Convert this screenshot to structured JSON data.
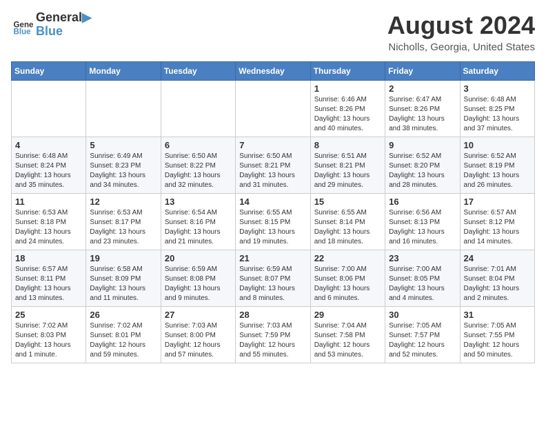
{
  "header": {
    "logo": {
      "line1": "General",
      "line2": "Blue"
    },
    "title": "August 2024",
    "location": "Nicholls, Georgia, United States"
  },
  "weekdays": [
    "Sunday",
    "Monday",
    "Tuesday",
    "Wednesday",
    "Thursday",
    "Friday",
    "Saturday"
  ],
  "weeks": [
    [
      {
        "day": "",
        "info": ""
      },
      {
        "day": "",
        "info": ""
      },
      {
        "day": "",
        "info": ""
      },
      {
        "day": "",
        "info": ""
      },
      {
        "day": "1",
        "info": "Sunrise: 6:46 AM\nSunset: 8:26 PM\nDaylight: 13 hours\nand 40 minutes."
      },
      {
        "day": "2",
        "info": "Sunrise: 6:47 AM\nSunset: 8:26 PM\nDaylight: 13 hours\nand 38 minutes."
      },
      {
        "day": "3",
        "info": "Sunrise: 6:48 AM\nSunset: 8:25 PM\nDaylight: 13 hours\nand 37 minutes."
      }
    ],
    [
      {
        "day": "4",
        "info": "Sunrise: 6:48 AM\nSunset: 8:24 PM\nDaylight: 13 hours\nand 35 minutes."
      },
      {
        "day": "5",
        "info": "Sunrise: 6:49 AM\nSunset: 8:23 PM\nDaylight: 13 hours\nand 34 minutes."
      },
      {
        "day": "6",
        "info": "Sunrise: 6:50 AM\nSunset: 8:22 PM\nDaylight: 13 hours\nand 32 minutes."
      },
      {
        "day": "7",
        "info": "Sunrise: 6:50 AM\nSunset: 8:21 PM\nDaylight: 13 hours\nand 31 minutes."
      },
      {
        "day": "8",
        "info": "Sunrise: 6:51 AM\nSunset: 8:21 PM\nDaylight: 13 hours\nand 29 minutes."
      },
      {
        "day": "9",
        "info": "Sunrise: 6:52 AM\nSunset: 8:20 PM\nDaylight: 13 hours\nand 28 minutes."
      },
      {
        "day": "10",
        "info": "Sunrise: 6:52 AM\nSunset: 8:19 PM\nDaylight: 13 hours\nand 26 minutes."
      }
    ],
    [
      {
        "day": "11",
        "info": "Sunrise: 6:53 AM\nSunset: 8:18 PM\nDaylight: 13 hours\nand 24 minutes."
      },
      {
        "day": "12",
        "info": "Sunrise: 6:53 AM\nSunset: 8:17 PM\nDaylight: 13 hours\nand 23 minutes."
      },
      {
        "day": "13",
        "info": "Sunrise: 6:54 AM\nSunset: 8:16 PM\nDaylight: 13 hours\nand 21 minutes."
      },
      {
        "day": "14",
        "info": "Sunrise: 6:55 AM\nSunset: 8:15 PM\nDaylight: 13 hours\nand 19 minutes."
      },
      {
        "day": "15",
        "info": "Sunrise: 6:55 AM\nSunset: 8:14 PM\nDaylight: 13 hours\nand 18 minutes."
      },
      {
        "day": "16",
        "info": "Sunrise: 6:56 AM\nSunset: 8:13 PM\nDaylight: 13 hours\nand 16 minutes."
      },
      {
        "day": "17",
        "info": "Sunrise: 6:57 AM\nSunset: 8:12 PM\nDaylight: 13 hours\nand 14 minutes."
      }
    ],
    [
      {
        "day": "18",
        "info": "Sunrise: 6:57 AM\nSunset: 8:11 PM\nDaylight: 13 hours\nand 13 minutes."
      },
      {
        "day": "19",
        "info": "Sunrise: 6:58 AM\nSunset: 8:09 PM\nDaylight: 13 hours\nand 11 minutes."
      },
      {
        "day": "20",
        "info": "Sunrise: 6:59 AM\nSunset: 8:08 PM\nDaylight: 13 hours\nand 9 minutes."
      },
      {
        "day": "21",
        "info": "Sunrise: 6:59 AM\nSunset: 8:07 PM\nDaylight: 13 hours\nand 8 minutes."
      },
      {
        "day": "22",
        "info": "Sunrise: 7:00 AM\nSunset: 8:06 PM\nDaylight: 13 hours\nand 6 minutes."
      },
      {
        "day": "23",
        "info": "Sunrise: 7:00 AM\nSunset: 8:05 PM\nDaylight: 13 hours\nand 4 minutes."
      },
      {
        "day": "24",
        "info": "Sunrise: 7:01 AM\nSunset: 8:04 PM\nDaylight: 13 hours\nand 2 minutes."
      }
    ],
    [
      {
        "day": "25",
        "info": "Sunrise: 7:02 AM\nSunset: 8:03 PM\nDaylight: 13 hours\nand 1 minute."
      },
      {
        "day": "26",
        "info": "Sunrise: 7:02 AM\nSunset: 8:01 PM\nDaylight: 12 hours\nand 59 minutes."
      },
      {
        "day": "27",
        "info": "Sunrise: 7:03 AM\nSunset: 8:00 PM\nDaylight: 12 hours\nand 57 minutes."
      },
      {
        "day": "28",
        "info": "Sunrise: 7:03 AM\nSunset: 7:59 PM\nDaylight: 12 hours\nand 55 minutes."
      },
      {
        "day": "29",
        "info": "Sunrise: 7:04 AM\nSunset: 7:58 PM\nDaylight: 12 hours\nand 53 minutes."
      },
      {
        "day": "30",
        "info": "Sunrise: 7:05 AM\nSunset: 7:57 PM\nDaylight: 12 hours\nand 52 minutes."
      },
      {
        "day": "31",
        "info": "Sunrise: 7:05 AM\nSunset: 7:55 PM\nDaylight: 12 hours\nand 50 minutes."
      }
    ]
  ]
}
